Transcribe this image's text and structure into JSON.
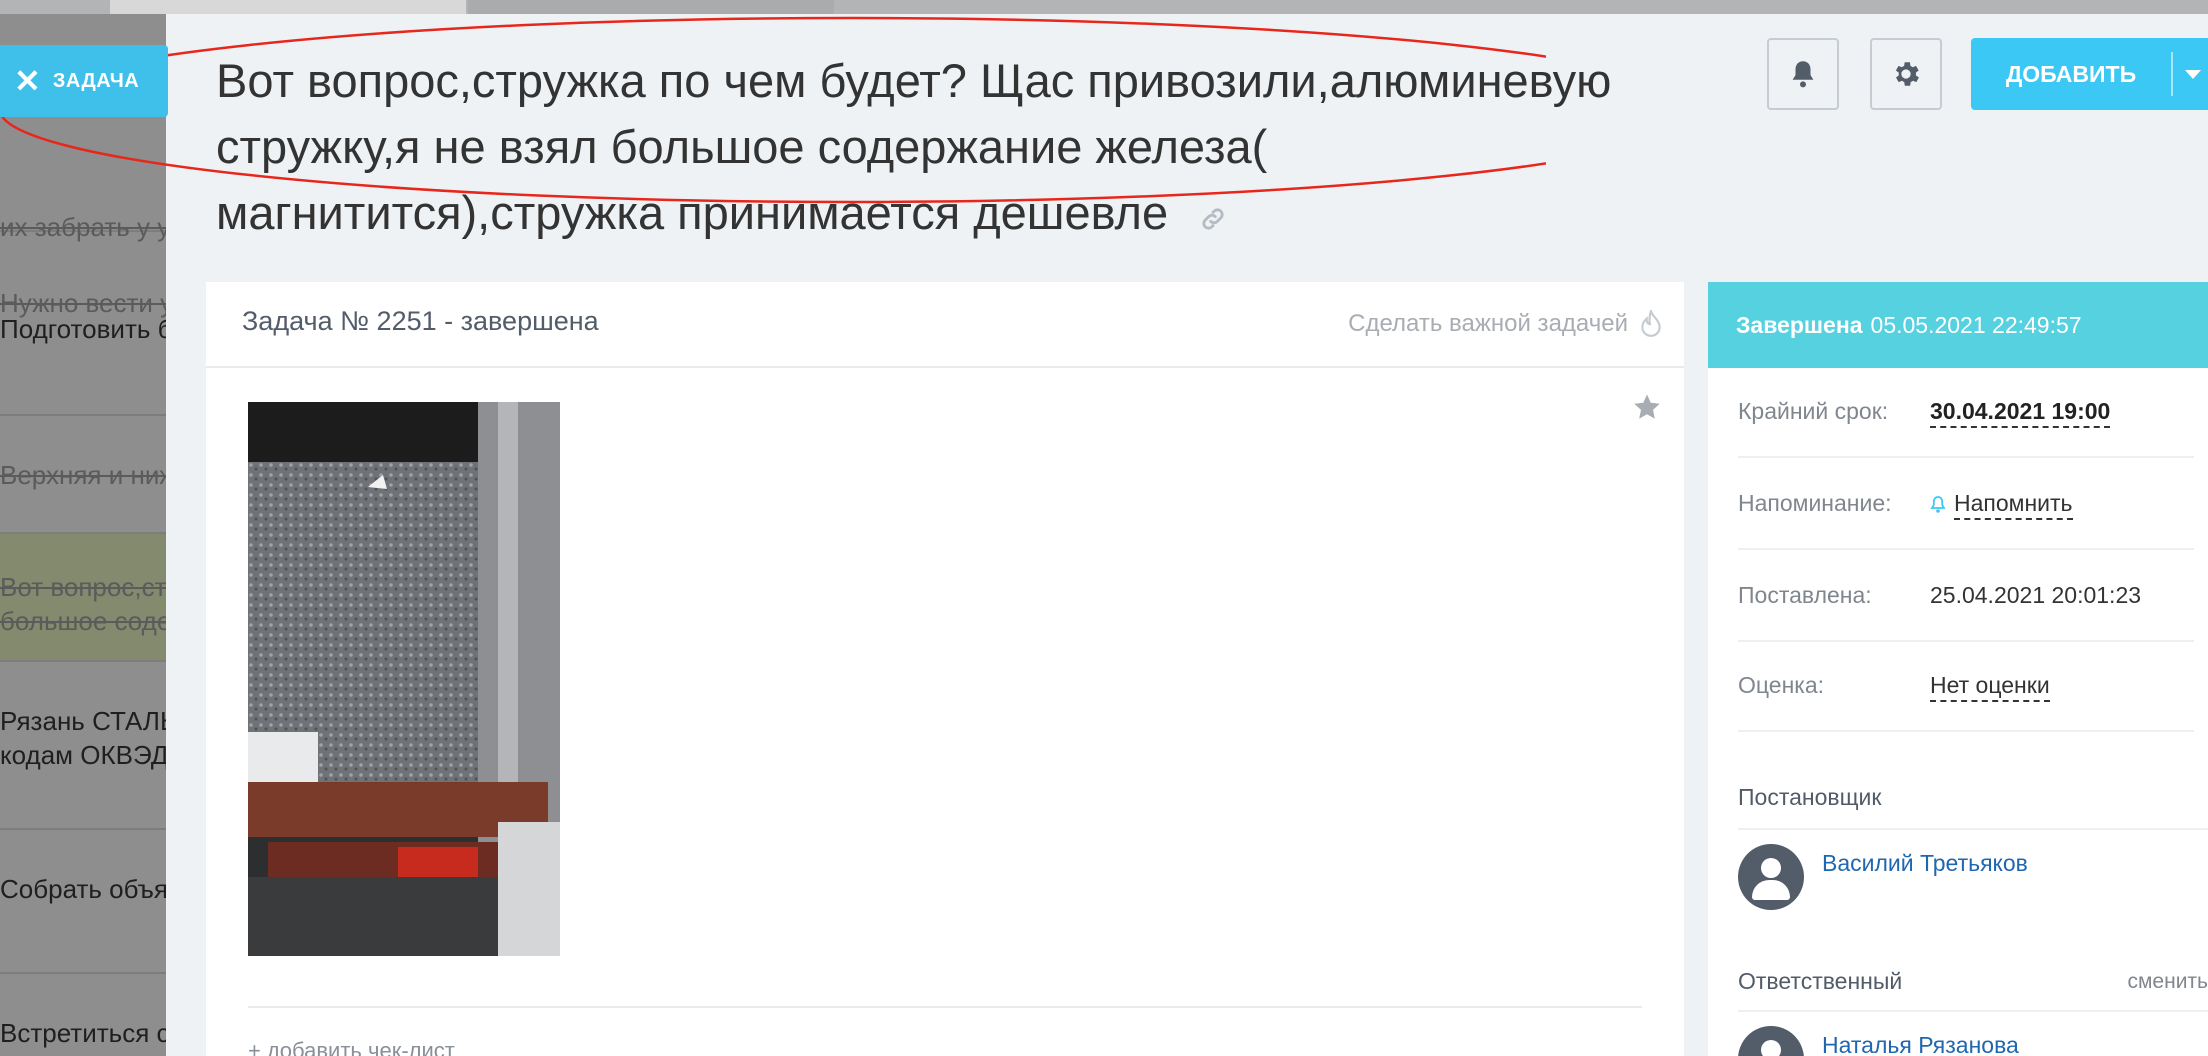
{
  "background_list": {
    "rows": [
      {
        "text": "Нужно вести учёт",
        "text2": "их забрать у у"
      },
      {
        "text": "Подготовить б"
      },
      {
        "text": "Верхняя и ниж"
      },
      {
        "text": "Вот вопрос,ст",
        "text2": "большое соде"
      },
      {
        "text": "Рязань СТАЛЬ",
        "text2": "кодам ОКВЭД"
      },
      {
        "text": "Собрать объя"
      },
      {
        "text": "Встретиться с"
      }
    ]
  },
  "close_tab": {
    "label": "ЗАДАЧА",
    "icon": "close-icon"
  },
  "header": {
    "title": "Вот вопрос,стружка по чем будет? Щас привозили,алюминевую стружку,я не взял большое содержание железа( магнититься),стружка принимается дешевле",
    "title_lines": [
      "Вот вопрос,стружка по чем будет? Щас привозили,алюминевую",
      "стружку,я не взял большое содержание железа(",
      "магнитится),стружка принимается дешевле"
    ],
    "add_button": "ДОБАВИТЬ",
    "annotation_color": "#e8271c"
  },
  "card": {
    "title": "Задача № 2251 - завершена",
    "make_important": "Сделать важной задачей",
    "add_checklist": "+ добавить чек-лист"
  },
  "sidebar": {
    "status_label": "Завершена",
    "status_date": "05.05.2021 22:49:57",
    "rows": [
      {
        "key": "Крайний срок:",
        "value": "30.04.2021 19:00"
      },
      {
        "key": "Напоминание:",
        "value": "Напомнить"
      },
      {
        "key": "Поставлена:",
        "value": "25.04.2021 20:01:23"
      },
      {
        "key": "Оценка:",
        "value": "Нет оценки"
      }
    ],
    "creator_label": "Постановщик",
    "creator_name": "Василий Третьяков",
    "responsible_label": "Ответственный",
    "change_link": "сменить",
    "responsible_name": "Наталья Рязанова"
  },
  "colors": {
    "accent": "#3bc8f5",
    "status_bar": "#56d1e0",
    "link": "#2067b0"
  }
}
